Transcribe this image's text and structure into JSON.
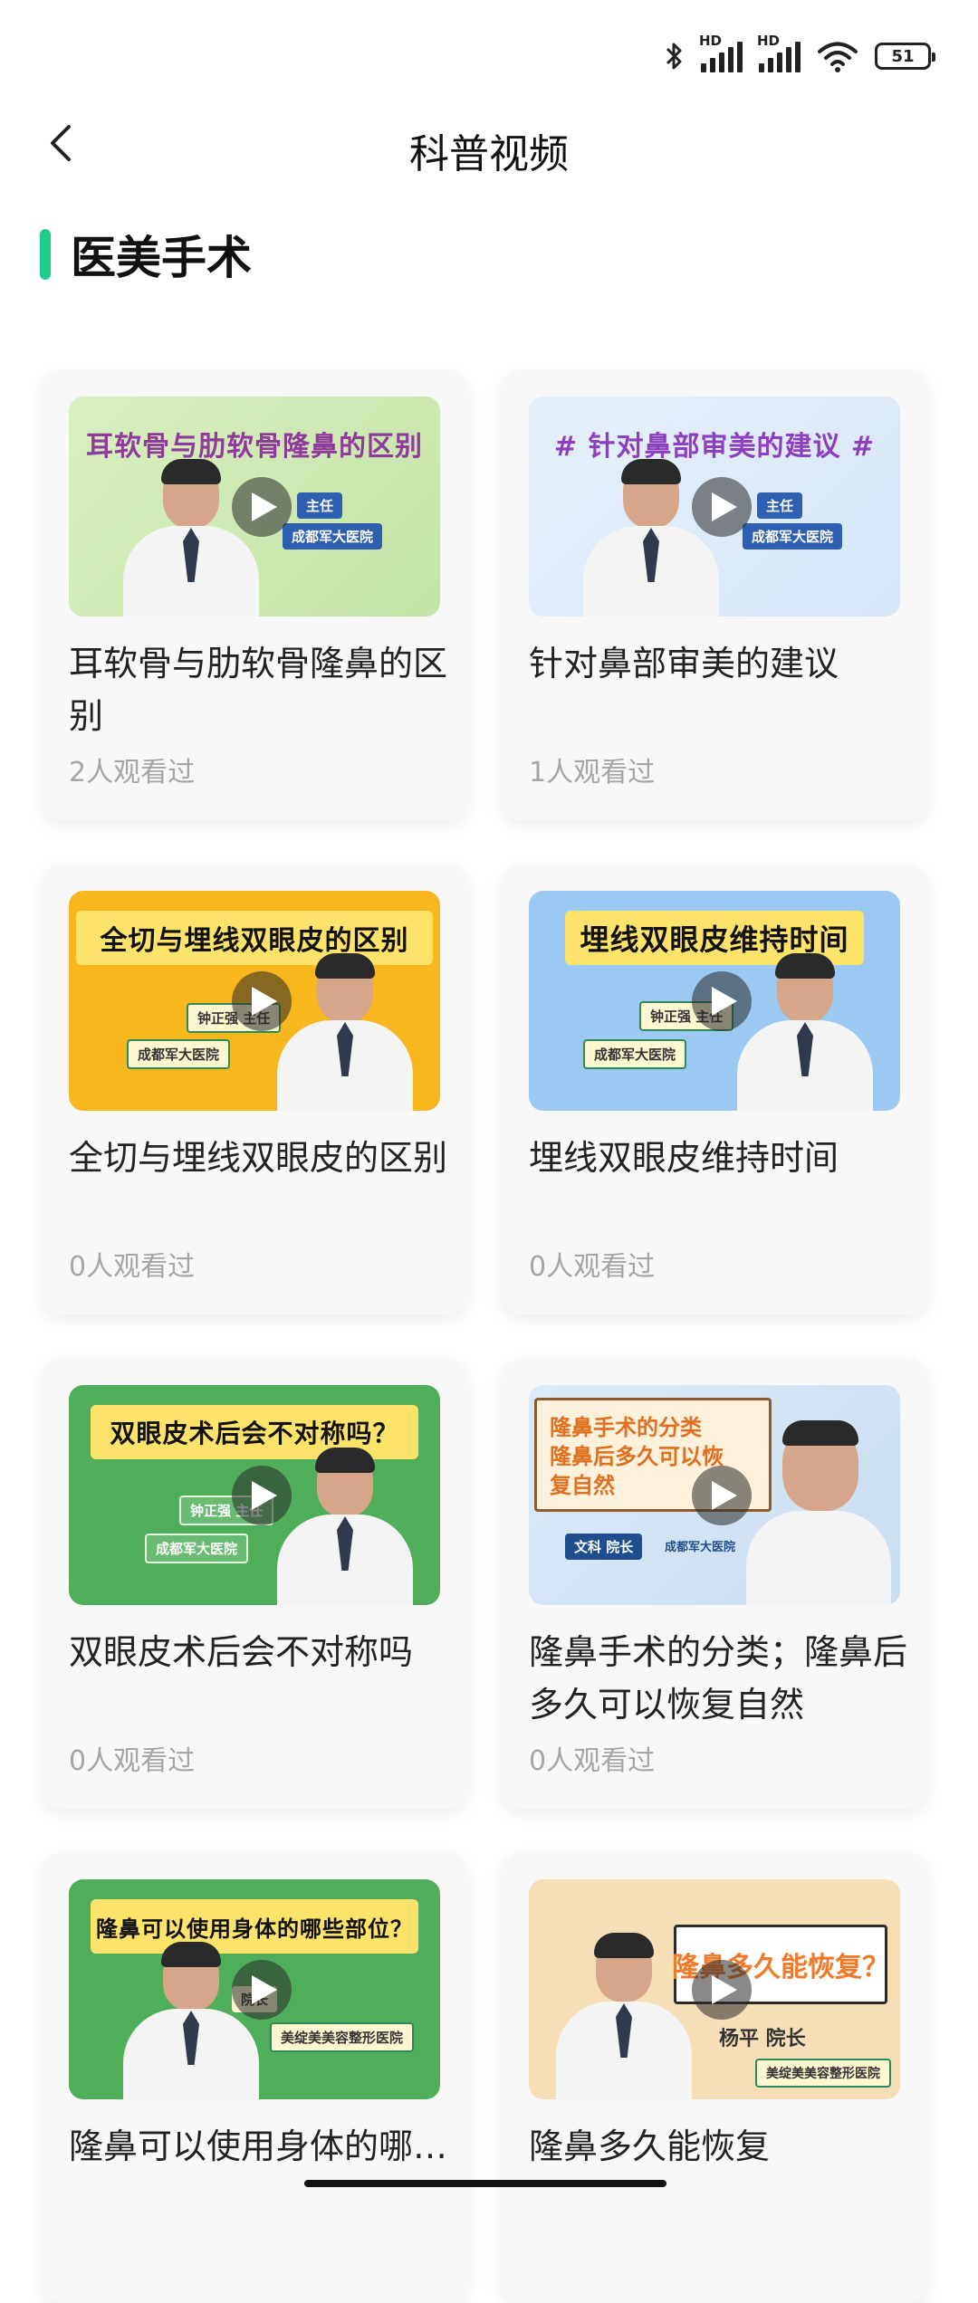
{
  "status_bar": {
    "battery": "51",
    "hd_label": "HD"
  },
  "nav": {
    "title": "科普视频"
  },
  "section": {
    "title": "医美手术"
  },
  "colors": {
    "accent": "#1ecb8b"
  },
  "cards": [
    {
      "title": "耳软骨与肋软骨隆鼻的区别",
      "views": "2人观看过",
      "thumb_text": "耳软骨与肋软骨隆鼻的区别",
      "tag1": "主任",
      "tag2": "成都军大医院"
    },
    {
      "title": "针对鼻部审美的建议",
      "views": "1人观看过",
      "thumb_text": "# 针对鼻部审美的建议 #",
      "tag1": "主任",
      "tag2": "成都军大医院"
    },
    {
      "title": "全切与埋线双眼皮的区别",
      "views": "0人观看过",
      "thumb_text": "全切与埋线双眼皮的区别",
      "tag1": "钟正强 主任",
      "tag2": "成都军大医院"
    },
    {
      "title": "埋线双眼皮维持时间",
      "views": "0人观看过",
      "thumb_text": "埋线双眼皮维持时间",
      "tag1": "钟正强 主任",
      "tag2": "成都军大医院"
    },
    {
      "title": "双眼皮术后会不对称吗",
      "views": "0人观看过",
      "thumb_text": "双眼皮术后会不对称吗？",
      "tag1": "钟正强 主任",
      "tag2": "成都军大医院"
    },
    {
      "title": "隆鼻手术的分类；隆鼻后多久可以恢复自然",
      "views": "0人观看过",
      "thumb_text": "隆鼻手术的分类",
      "thumb_text2": "隆鼻后多久可以恢复自然",
      "tag1": "文科 院长",
      "tag2": "成都军大医院"
    },
    {
      "title": "隆鼻可以使用身体的哪些部位",
      "views": "",
      "thumb_text": "隆鼻可以使用身体的哪些部位？",
      "tag1": "院长",
      "tag2": "美绽美美容整形医院"
    },
    {
      "title": "隆鼻多久能恢复",
      "views": "",
      "thumb_text": "隆鼻多久能恢复？",
      "tag1": "杨平 院长",
      "tag2": "美绽美美容整形医院"
    }
  ]
}
